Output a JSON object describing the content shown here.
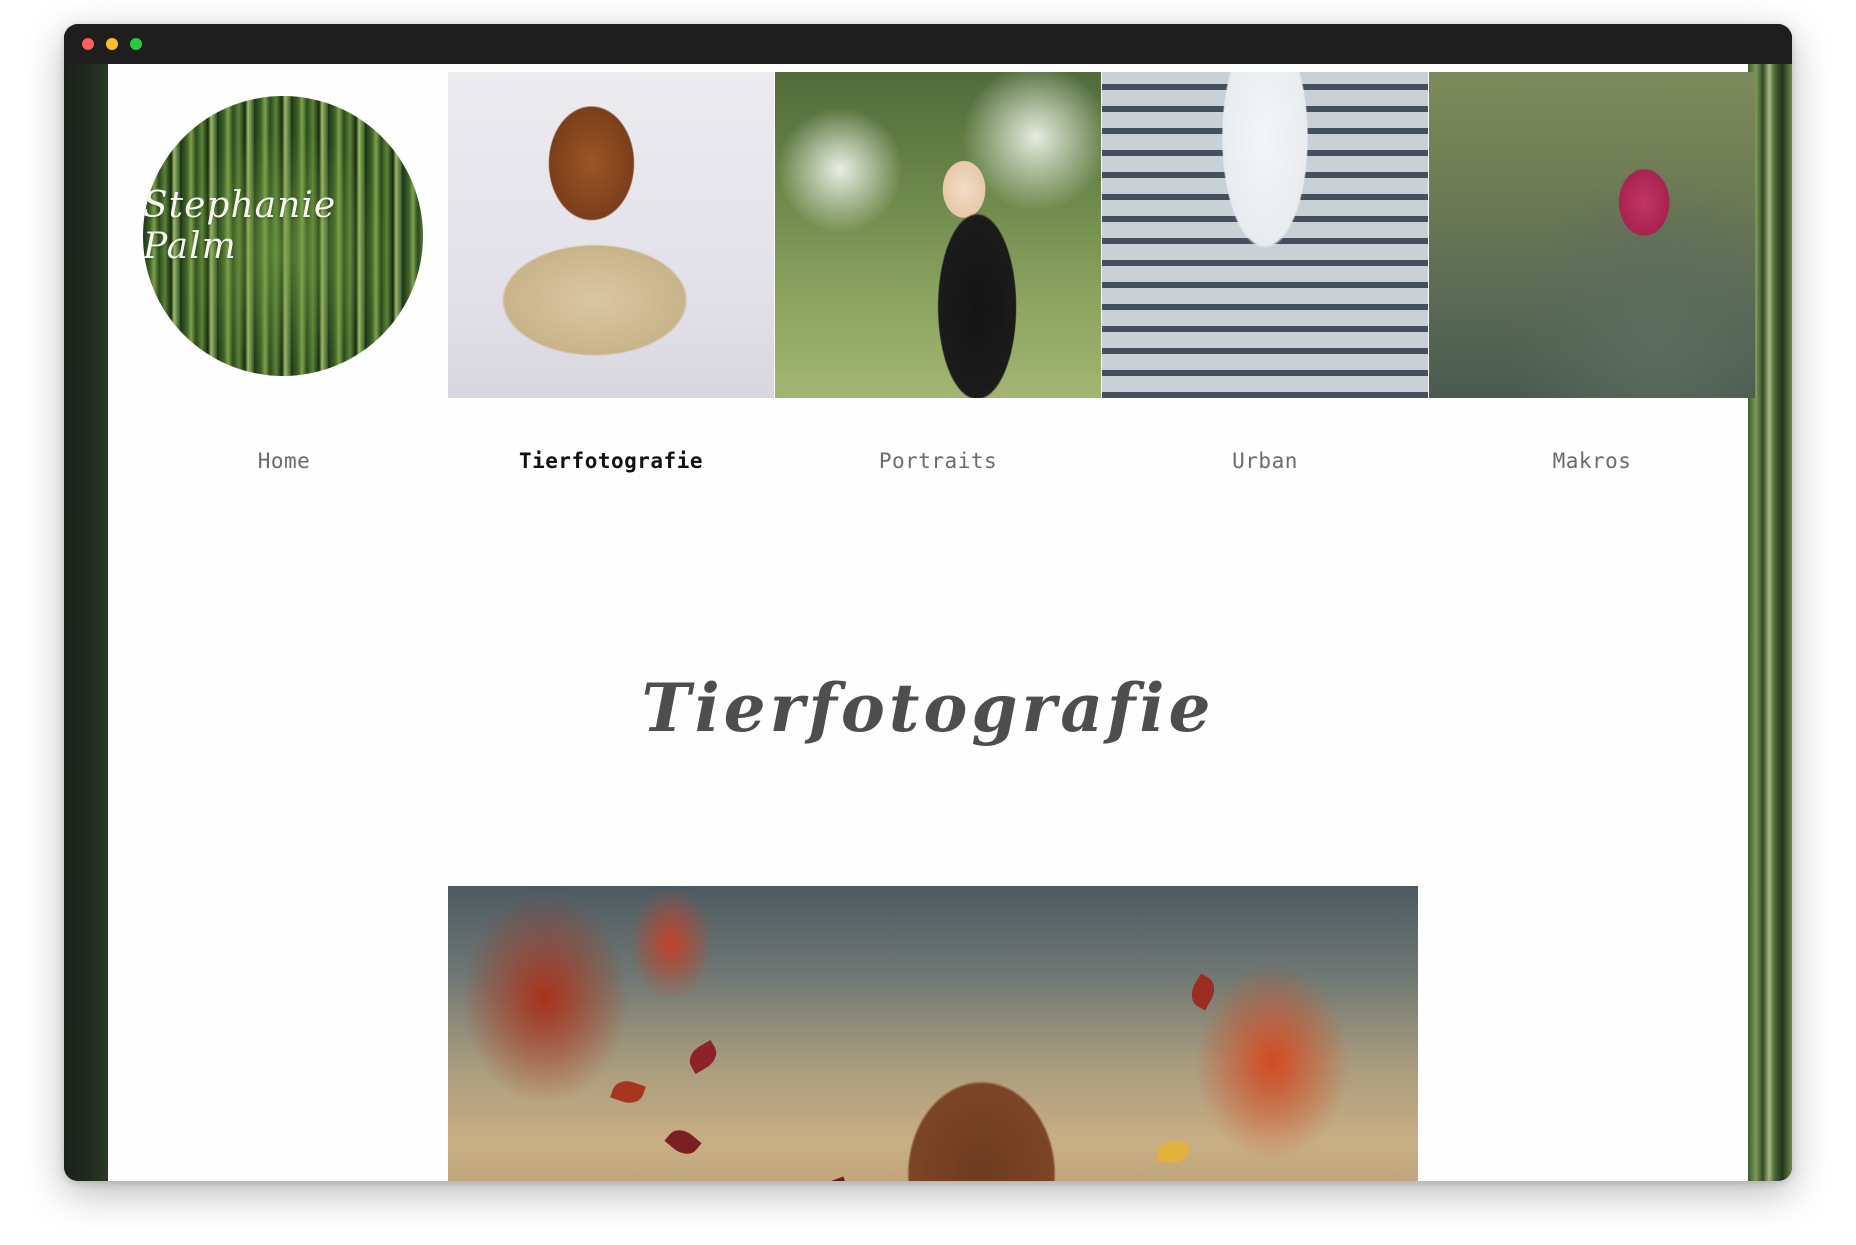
{
  "site": {
    "logo_text": "Stephanie Palm"
  },
  "header_images": [
    {
      "name": "puppy-photo",
      "subject": "dachshund puppy in basket"
    },
    {
      "name": "portrait-photo",
      "subject": "woman holding pug"
    },
    {
      "name": "urban-photo",
      "subject": "building facade"
    },
    {
      "name": "macro-photo",
      "subject": "pink flower"
    }
  ],
  "nav": {
    "items": [
      {
        "label": "Home",
        "active": false
      },
      {
        "label": "Tierfotografie",
        "active": true
      },
      {
        "label": "Portraits",
        "active": false
      },
      {
        "label": "Urban",
        "active": false
      },
      {
        "label": "Makros",
        "active": false
      }
    ]
  },
  "main": {
    "title": "Tierfotografie"
  },
  "colors": {
    "nav_text": "#6b6b6b",
    "nav_active": "#111111",
    "title_text": "#4e4e4e",
    "window_chrome": "#1e1e1e"
  }
}
